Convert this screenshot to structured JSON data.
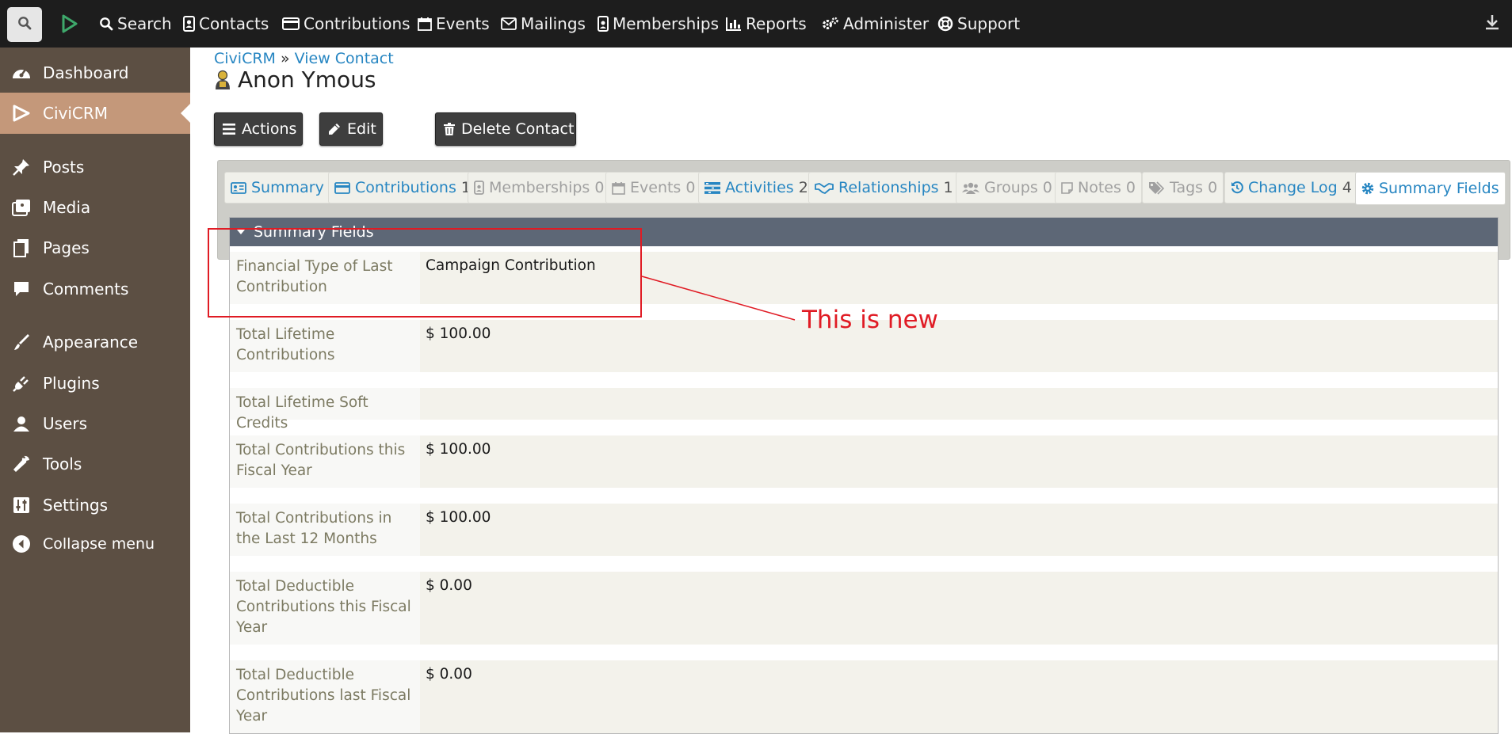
{
  "topnav": {
    "items": [
      {
        "label": "Search",
        "icon": "search-icon"
      },
      {
        "label": "Contacts",
        "icon": "contact-card-icon"
      },
      {
        "label": "Contributions",
        "icon": "credit-card-icon"
      },
      {
        "label": "Events",
        "icon": "calendar-icon"
      },
      {
        "label": "Mailings",
        "icon": "envelope-icon"
      },
      {
        "label": "Memberships",
        "icon": "id-badge-icon"
      },
      {
        "label": "Reports",
        "icon": "bar-chart-icon"
      },
      {
        "label": "Administer",
        "icon": "gears-icon"
      },
      {
        "label": "Support",
        "icon": "life-ring-icon"
      }
    ]
  },
  "sidebar": {
    "items": [
      {
        "label": "Dashboard",
        "icon": "gauge-icon"
      },
      {
        "label": "CiviCRM",
        "icon": "civicrm-icon"
      },
      {
        "label": "Posts",
        "icon": "pushpin-icon"
      },
      {
        "label": "Media",
        "icon": "media-icon"
      },
      {
        "label": "Pages",
        "icon": "pages-icon"
      },
      {
        "label": "Comments",
        "icon": "comment-icon"
      },
      {
        "label": "Appearance",
        "icon": "paintbrush-icon"
      },
      {
        "label": "Plugins",
        "icon": "plug-icon"
      },
      {
        "label": "Users",
        "icon": "user-icon"
      },
      {
        "label": "Tools",
        "icon": "wrench-icon"
      },
      {
        "label": "Settings",
        "icon": "sliders-icon"
      },
      {
        "label": "Collapse menu",
        "icon": "collapse-arrow-icon"
      }
    ],
    "active": "CiviCRM"
  },
  "breadcrumb": {
    "root": "CiviCRM",
    "separator": "»",
    "current": "View Contact"
  },
  "contact": {
    "name": "Anon Ymous"
  },
  "actions": {
    "actions_label": "Actions",
    "edit_label": "Edit",
    "delete_label": "Delete Contact"
  },
  "tabs": [
    {
      "label": "Summary",
      "count": "",
      "state": "active",
      "icon": "id-card-icon"
    },
    {
      "label": "Contributions",
      "count": "1",
      "state": "active",
      "icon": "credit-card-icon"
    },
    {
      "label": "Memberships",
      "count": "0",
      "state": "disabled",
      "icon": "id-badge-icon"
    },
    {
      "label": "Events",
      "count": "0",
      "state": "disabled",
      "icon": "calendar-icon"
    },
    {
      "label": "Activities",
      "count": "2",
      "state": "active",
      "icon": "tasks-icon"
    },
    {
      "label": "Relationships",
      "count": "1",
      "state": "active",
      "icon": "handshake-icon"
    },
    {
      "label": "Groups",
      "count": "0",
      "state": "disabled",
      "icon": "users-icon"
    },
    {
      "label": "Notes",
      "count": "0",
      "state": "disabled",
      "icon": "sticky-note-icon"
    },
    {
      "label": "Tags",
      "count": "0",
      "state": "disabled",
      "icon": "tags-icon"
    },
    {
      "label": "Change Log",
      "count": "4",
      "state": "active",
      "icon": "history-icon"
    },
    {
      "label": "Summary Fields",
      "count": "",
      "state": "selected",
      "icon": "gear-icon"
    }
  ],
  "panel": {
    "title": "Summary Fields",
    "rows": [
      {
        "label": "Financial Type of Last Contribution",
        "value": "Campaign Contribution"
      },
      {
        "label": "Total Lifetime Contributions",
        "value": "$ 100.00"
      },
      {
        "label": "Total Lifetime Soft Credits",
        "value": ""
      },
      {
        "label": "Total Contributions this Fiscal Year",
        "value": "$ 100.00"
      },
      {
        "label": "Total Contributions in the Last 12 Months",
        "value": "$ 100.00"
      },
      {
        "label": "Total Deductible Contributions this Fiscal Year",
        "value": "$ 0.00"
      },
      {
        "label": "Total Deductible Contributions last Fiscal Year",
        "value": "$ 0.00"
      }
    ]
  },
  "annotation": {
    "text": "This is new",
    "color": "#e01b24"
  },
  "colors": {
    "topbar_bg": "#1d1d1d",
    "sidebar_bg": "#5c4f43",
    "sidebar_active": "#c4987a",
    "link": "#2786c2",
    "panel_header": "#5d6776",
    "button_bg": "#3e3e3e"
  }
}
